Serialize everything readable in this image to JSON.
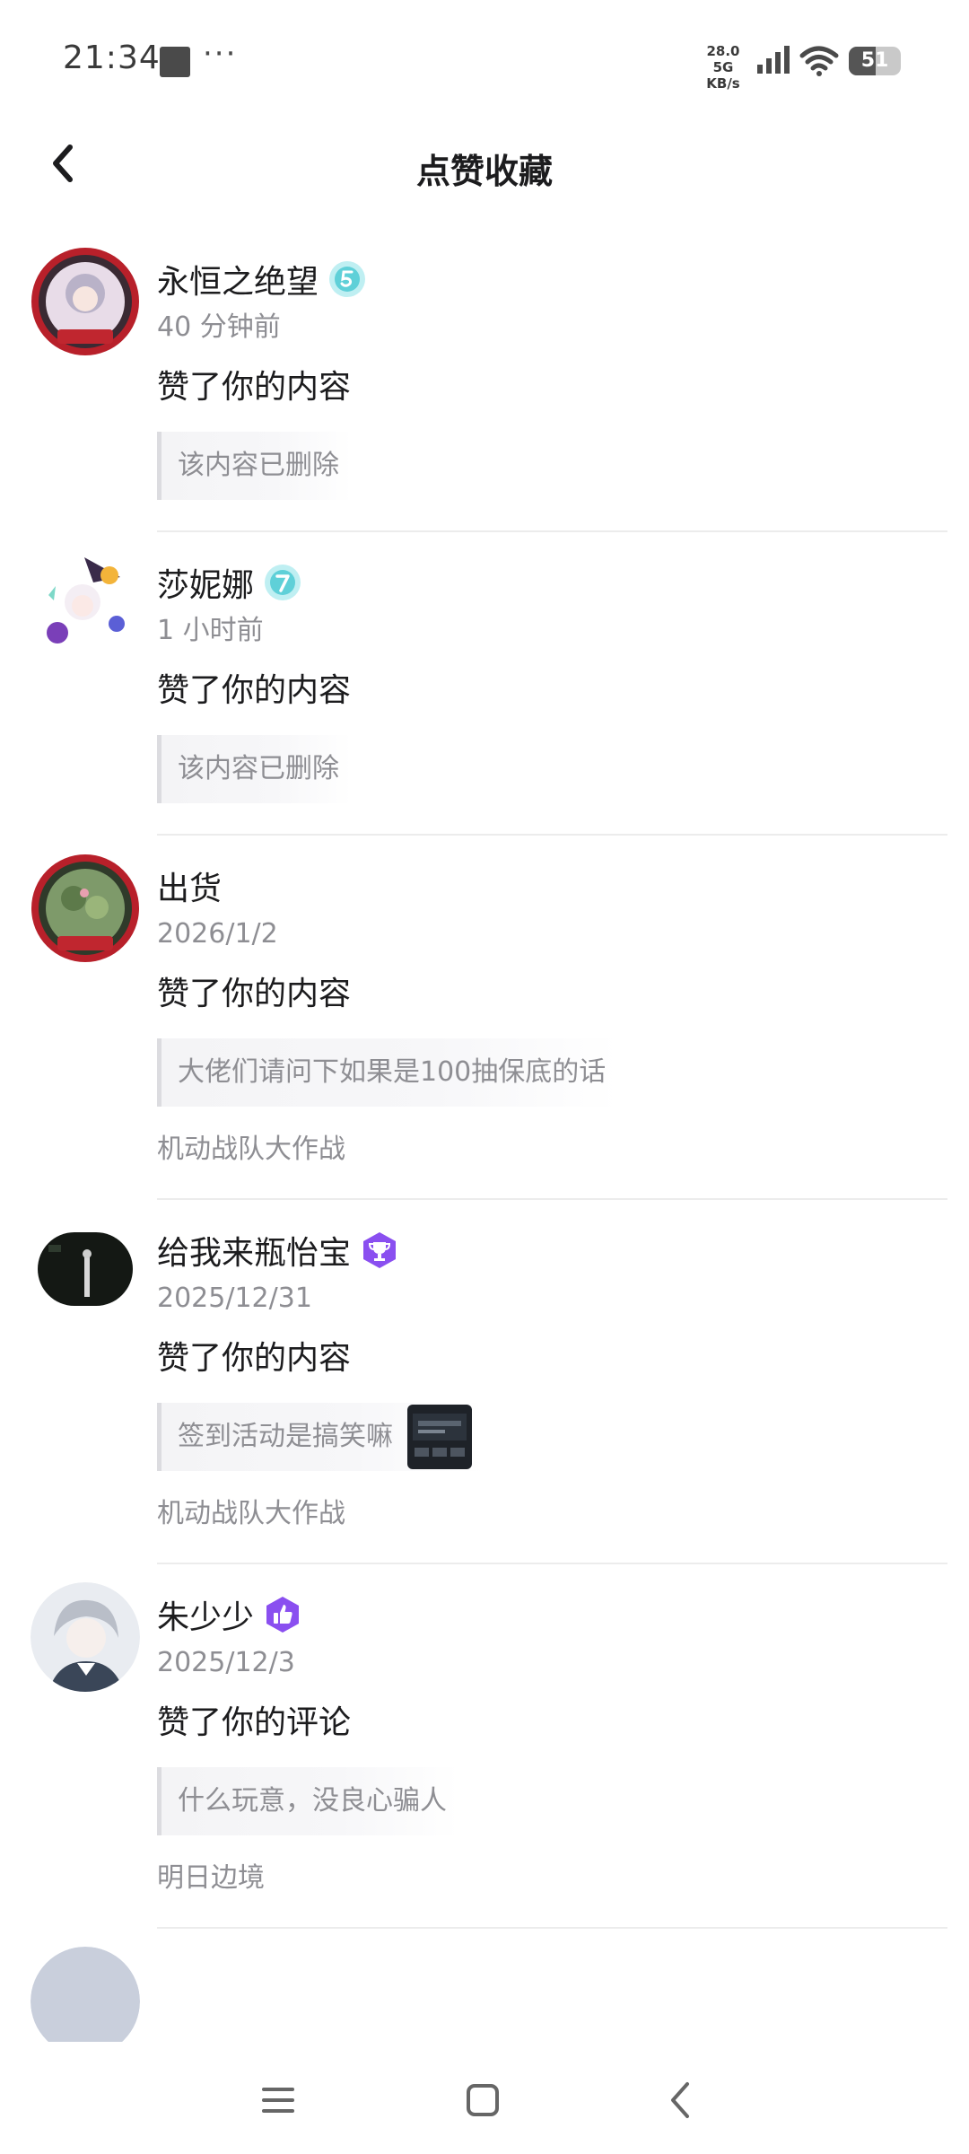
{
  "status_bar": {
    "time": "21:34",
    "more": "···",
    "speed_top": "28.0 5G",
    "speed_bottom": "KB/s",
    "battery": "51",
    "battery_level": 0.51
  },
  "header": {
    "title": "点赞收藏"
  },
  "feed": {
    "items": [
      {
        "name": "永恒之绝望",
        "badge": "level-5-icon",
        "time": "40 分钟前",
        "action": "赞了你的内容",
        "quote": "该内容已删除",
        "game": ""
      },
      {
        "name": "莎妮娜",
        "badge": "level-7-icon",
        "time": "1 小时前",
        "action": "赞了你的内容",
        "quote": "该内容已删除",
        "game": ""
      },
      {
        "name": "出货",
        "badge": "",
        "time": "2026/1/2",
        "action": "赞了你的内容",
        "quote": "大佬们请问下如果是100抽保底的话",
        "game": "机动战队大作战"
      },
      {
        "name": "给我来瓶怡宝",
        "badge": "trophy-badge-icon",
        "time": "2025/12/31",
        "action": "赞了你的内容",
        "quote": "签到活动是搞笑嘛",
        "game": "机动战队大作战"
      },
      {
        "name": "朱少少",
        "badge": "thumbs-up-badge-icon",
        "time": "2025/12/3",
        "action": "赞了你的评论",
        "quote": "什么玩意，没良心骗人",
        "game": "明日边境"
      }
    ]
  },
  "navbar": {
    "menu_icon": "menu-icon",
    "home_icon": "home-square-icon",
    "back_icon": "back-triangle-icon"
  },
  "colors": {
    "text_primary": "#1c1c1e",
    "text_secondary": "#8e8e93",
    "divider": "#ececec",
    "badge_teal": "#5fd0d8",
    "badge_purple": "#8a4ff0"
  }
}
